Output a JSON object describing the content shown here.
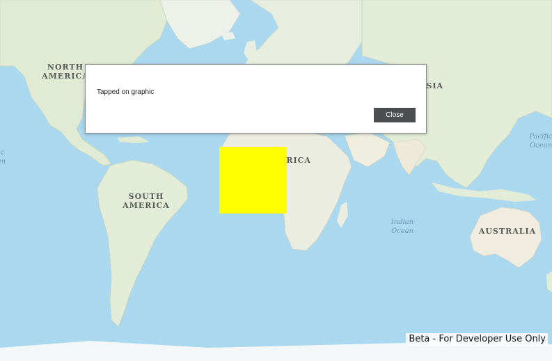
{
  "map": {
    "continent_labels": {
      "north_america": "NORTH AMERICA",
      "south_america": "SOUTH AMERICA",
      "africa": "AFRICA",
      "asia": "ASIA",
      "australia": "AUSTRALIA"
    },
    "ocean_labels": {
      "indian_ocean": "Indian Ocean",
      "pacific_ocean_east": "Pacific Ocean",
      "pacific_ocean_west": "ic an"
    },
    "graphic": {
      "color": "#ffff00",
      "shape": "square"
    }
  },
  "dialog": {
    "message": "Tapped on graphic",
    "close_label": "Close"
  },
  "watermark": "Beta - For Developer Use Only",
  "colors": {
    "ocean": "#a9d8ef",
    "land": "#e6eedb",
    "button": "#4c4f51"
  }
}
